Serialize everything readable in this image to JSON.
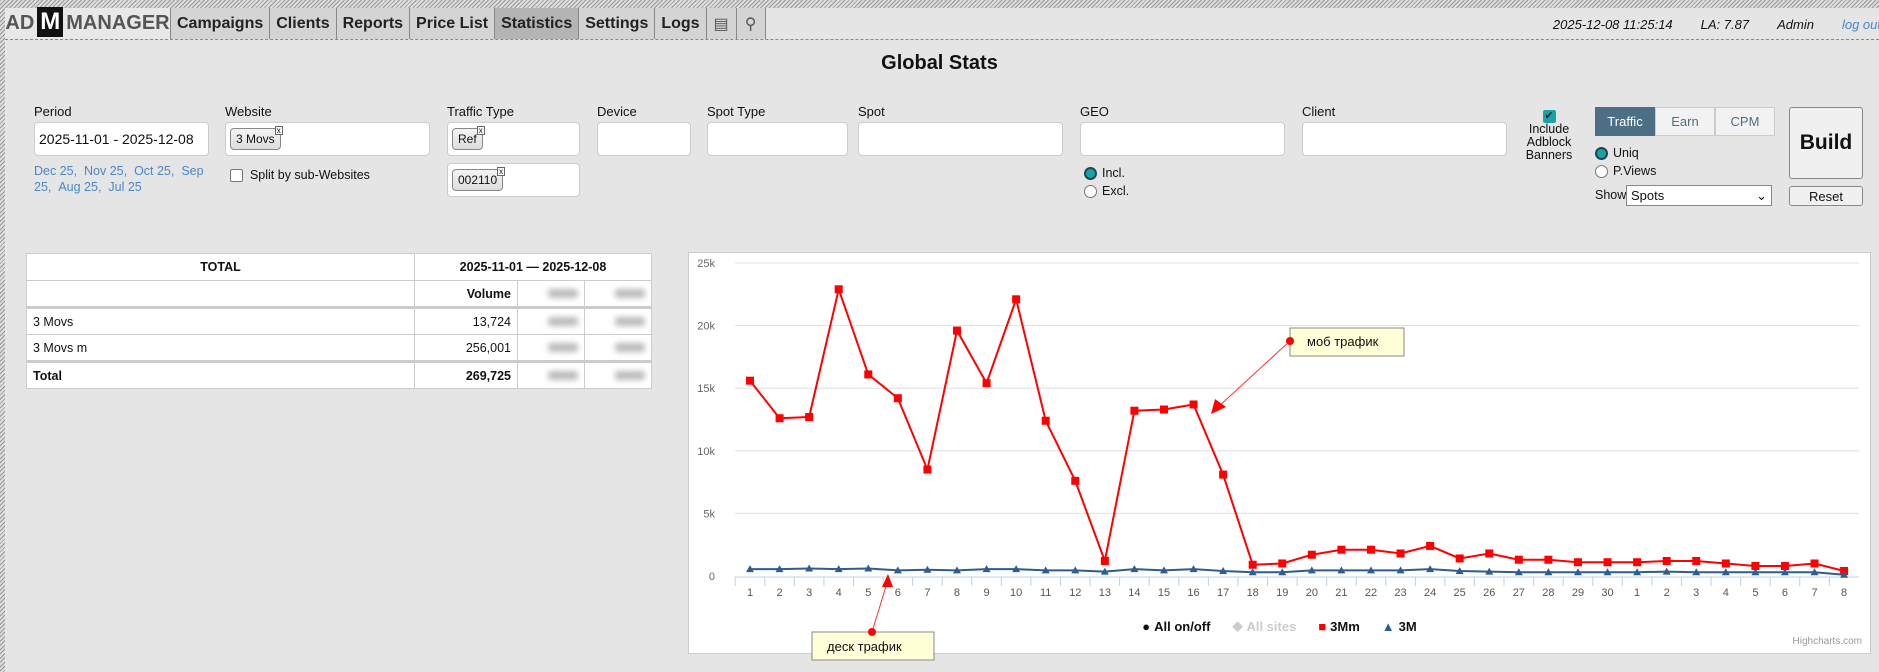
{
  "header": {
    "logo": {
      "left": "AD",
      "mid": "M",
      "right": "MANAGER"
    },
    "nav": [
      "Campaigns",
      "Clients",
      "Reports",
      "Price List",
      "Statistics",
      "Settings",
      "Logs"
    ],
    "active": "Statistics",
    "datetime": "2025-12-08 11:25:14",
    "la": "LA: 7.87",
    "user": "Admin",
    "logout": "log out"
  },
  "title": "Global Stats",
  "filters": {
    "period_label": "Period",
    "period_value": "2025-11-01 - 2025-12-08",
    "period_links": [
      "Dec 25",
      "Nov 25",
      "Oct 25",
      "Sep 25",
      "Aug 25",
      "Jul 25"
    ],
    "website_label": "Website",
    "website_chip": "3 Movs",
    "split_label": "Split by sub-Websites",
    "traffic_label": "Traffic Type",
    "traffic_chip": "Ref",
    "traffic_chip2": "002110",
    "device_label": "Device",
    "spot_type_label": "Spot Type",
    "spot_label": "Spot",
    "geo_label": "GEO",
    "geo_incl": "Incl.",
    "geo_excl": "Excl.",
    "client_label": "Client",
    "adblock_label": "Include Adblock Banners",
    "tabs": [
      "Traffic",
      "Earn",
      "CPM"
    ],
    "uniq": "Uniq",
    "pviews": "P.Views",
    "show_label": "Show",
    "show_value": "Spots",
    "build": "Build",
    "reset": "Reset"
  },
  "table": {
    "total_header": "TOTAL",
    "range_header": "2025-11-01 — 2025-12-08",
    "volume_header": "Volume",
    "rows": [
      {
        "name": "3 Movs",
        "volume": "13,724"
      },
      {
        "name": "3 Movs m",
        "volume": "256,001"
      }
    ],
    "total": {
      "name": "Total",
      "volume": "269,725"
    }
  },
  "chart_data": {
    "type": "line",
    "x": [
      "1",
      "2",
      "3",
      "4",
      "5",
      "6",
      "7",
      "8",
      "9",
      "10",
      "11",
      "12",
      "13",
      "14",
      "15",
      "16",
      "17",
      "18",
      "19",
      "20",
      "21",
      "22",
      "23",
      "24",
      "25",
      "26",
      "27",
      "28",
      "29",
      "30",
      "1",
      "2",
      "3",
      "4",
      "5",
      "6",
      "7",
      "8"
    ],
    "yticks": [
      "0",
      "5k",
      "10k",
      "15k",
      "20k",
      "25k"
    ],
    "ylim": [
      0,
      25000
    ],
    "series": [
      {
        "name": "All on/off",
        "color": "#000000",
        "values": []
      },
      {
        "name": "All sites",
        "color": "#cccccc",
        "values": []
      },
      {
        "name": "3Mm",
        "color": "#ff0000",
        "values": [
          15600,
          12600,
          12700,
          22900,
          16100,
          14200,
          8500,
          19600,
          15400,
          22100,
          12400,
          7600,
          1200,
          13200,
          13300,
          13700,
          8100,
          900,
          1000,
          1700,
          2100,
          2100,
          1800,
          2400,
          1400,
          1800,
          1300,
          1300,
          1100,
          1100,
          1100,
          1200,
          1200,
          1000,
          800,
          800,
          1000,
          400
        ]
      },
      {
        "name": "3M",
        "color": "#2f5e8e",
        "values": [
          550,
          550,
          600,
          550,
          600,
          450,
          500,
          450,
          550,
          550,
          450,
          450,
          350,
          550,
          450,
          550,
          400,
          300,
          300,
          450,
          450,
          450,
          450,
          550,
          400,
          350,
          300,
          300,
          300,
          300,
          300,
          350,
          300,
          300,
          300,
          300,
          300,
          100
        ]
      }
    ],
    "annotations": [
      "моб трафик",
      "деск трафик"
    ],
    "credits": "Highcharts.com"
  }
}
